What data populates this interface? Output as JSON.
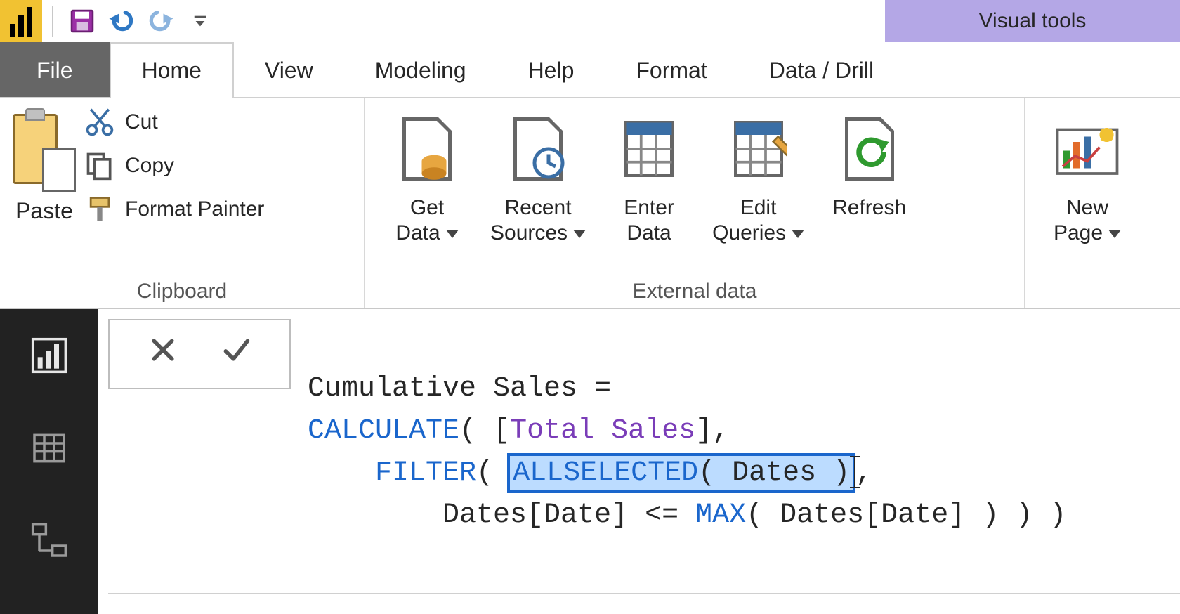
{
  "context_tab": "Visual tools",
  "tabs": {
    "file": "File",
    "home": "Home",
    "view": "View",
    "modeling": "Modeling",
    "help": "Help",
    "format": "Format",
    "data_drill": "Data / Drill"
  },
  "ribbon": {
    "clipboard": {
      "title": "Clipboard",
      "paste": "Paste",
      "cut": "Cut",
      "copy": "Copy",
      "format_painter": "Format Painter"
    },
    "external_data": {
      "title": "External data",
      "get_data": "Get\nData",
      "recent_sources": "Recent\nSources",
      "enter_data": "Enter\nData",
      "edit_queries": "Edit\nQueries",
      "refresh": "Refresh"
    },
    "insert": {
      "new_page": "New\nPage"
    }
  },
  "formula": {
    "line1_measure": "Cumulative Sales",
    "eq": " = ",
    "calc_fn": "CALCULATE",
    "total_sales": "Total Sales",
    "filter_fn": "FILTER",
    "allselected_fn": "ALLSELECTED",
    "dates_table": "Dates",
    "dates_col": "Dates[Date]",
    "lte": "<=",
    "max_fn": "MAX"
  }
}
